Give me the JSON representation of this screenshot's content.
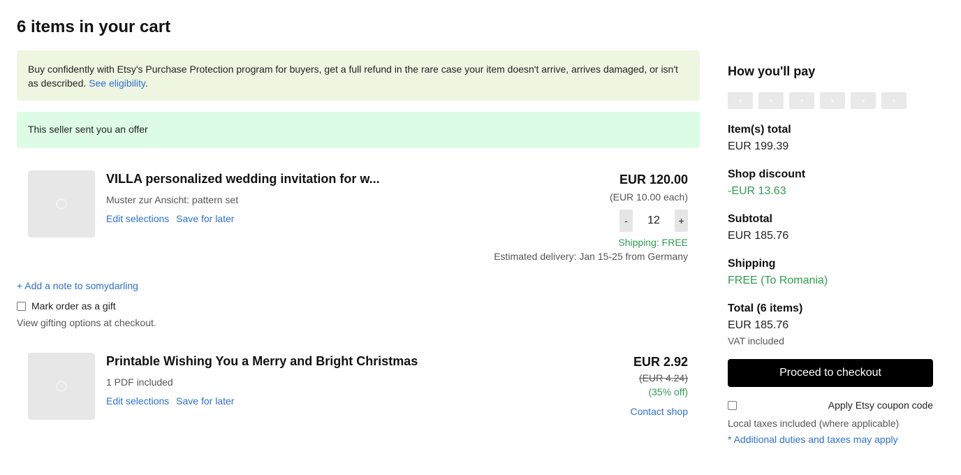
{
  "page": {
    "title": "6 items in your cart"
  },
  "banners": {
    "protection_text": "Buy confidently with Etsy's Purchase Protection program for buyers, get a full refund in the rare case your item doesn't arrive, arrives damaged, or isn't as described.",
    "protection_link": "See eligibility",
    "protection_end": ".",
    "offer_text": "This seller sent you an offer"
  },
  "items": [
    {
      "title": "VILLA personalized wedding invitation for w...",
      "variant": "Muster zur Ansicht: pattern set",
      "edit_label": "Edit selections",
      "save_label": "Save for later",
      "price": "EUR 120.00",
      "each": "(EUR 10.00 each)",
      "qty_minus": "-",
      "quantity": "12",
      "qty_plus": "+",
      "shipping": "Shipping: FREE",
      "delivery": "Estimated delivery: Jan 15-25 from Germany"
    },
    {
      "title": "Printable Wishing You a Merry and Bright Christmas",
      "variant": "1 PDF included",
      "edit_label": "Edit selections",
      "save_label": "Save for later",
      "price": "EUR 2.92",
      "old_price": "(EUR 4.24)",
      "discount": "(35% off)",
      "contact": "Contact shop"
    }
  ],
  "shop_options": {
    "add_note": "+ Add a note to somydarling",
    "gift_label": "Mark order as a gift",
    "gift_hint": "View gifting options at checkout."
  },
  "summary": {
    "title": "How you'll pay",
    "items_total_label": "Item(s) total",
    "items_total": "EUR 199.39",
    "shop_discount_label": "Shop discount",
    "shop_discount": "-EUR 13.63",
    "subtotal_label": "Subtotal",
    "subtotal": "EUR 185.76",
    "shipping_label": "Shipping",
    "shipping": "FREE (To Romania)",
    "total_label": "Total (6 items)",
    "total": "EUR 185.76",
    "vat": "VAT included",
    "checkout_label": "Proceed to checkout",
    "coupon_label": "Apply Etsy coupon code",
    "local_taxes": "Local taxes included (where applicable)",
    "duties": "* Additional duties and taxes may apply"
  },
  "colors": {
    "accent_link": "#2f6fd0",
    "success_green": "#2e9c4f",
    "checkout_bg": "#000000",
    "protection_bg": "#eef5e0",
    "offer_bg": "#dcfce6"
  }
}
